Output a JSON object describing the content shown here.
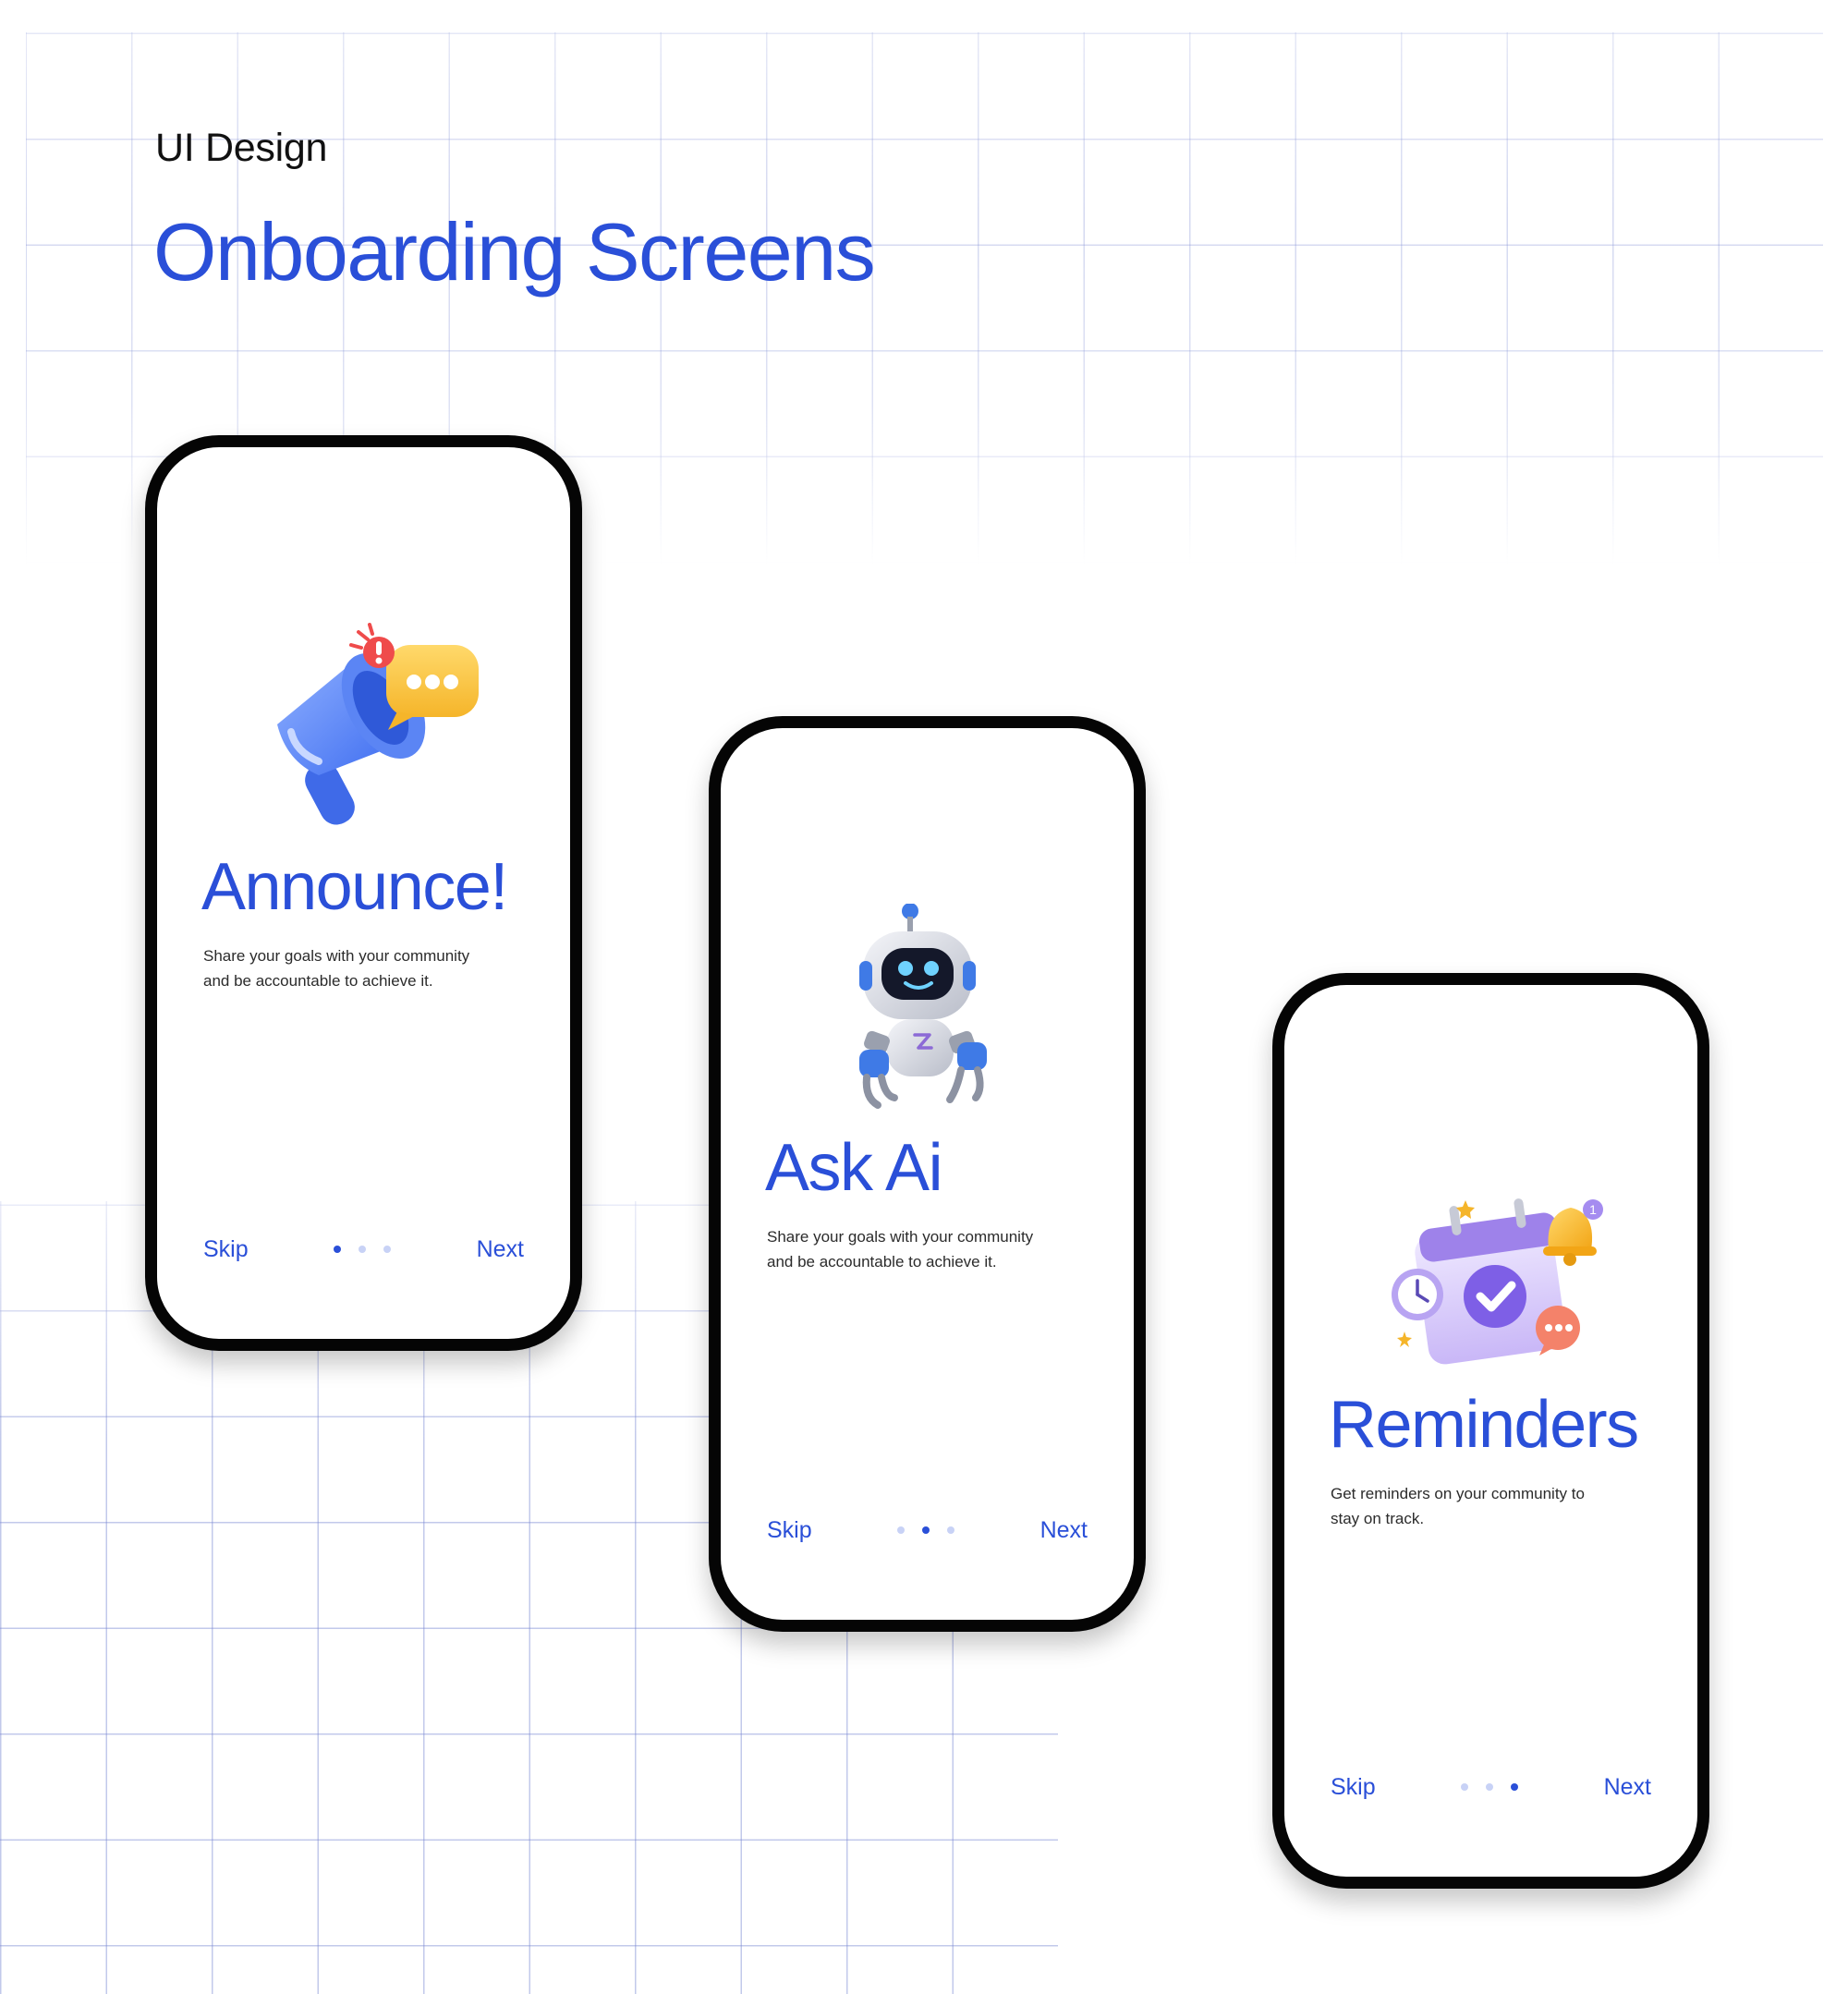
{
  "header": {
    "subtitle": "UI Design",
    "title": "Onboarding Screens"
  },
  "colors": {
    "accent": "#2a4fd8",
    "dot_inactive": "#c8d2f6",
    "phone_frame": "#050505",
    "grid": "#a9b4e6"
  },
  "screens": [
    {
      "illustration": "megaphone-icon",
      "title": "Announce!",
      "description_line1": "Share your goals with your community",
      "description_line2": "and be accountable to achieve it.",
      "skip_label": "Skip",
      "next_label": "Next",
      "active_page": 1,
      "total_pages": 3
    },
    {
      "illustration": "robot-icon",
      "title": "Ask Ai",
      "description_line1": "Share your goals with your community",
      "description_line2": "and be accountable to achieve it.",
      "skip_label": "Skip",
      "next_label": "Next",
      "active_page": 2,
      "total_pages": 3
    },
    {
      "illustration": "calendar-reminder-icon",
      "title": "Reminders",
      "description_line1": "Get reminders on your community to",
      "description_line2": "stay on track.",
      "skip_label": "Skip",
      "next_label": "Next",
      "active_page": 3,
      "total_pages": 3
    }
  ]
}
